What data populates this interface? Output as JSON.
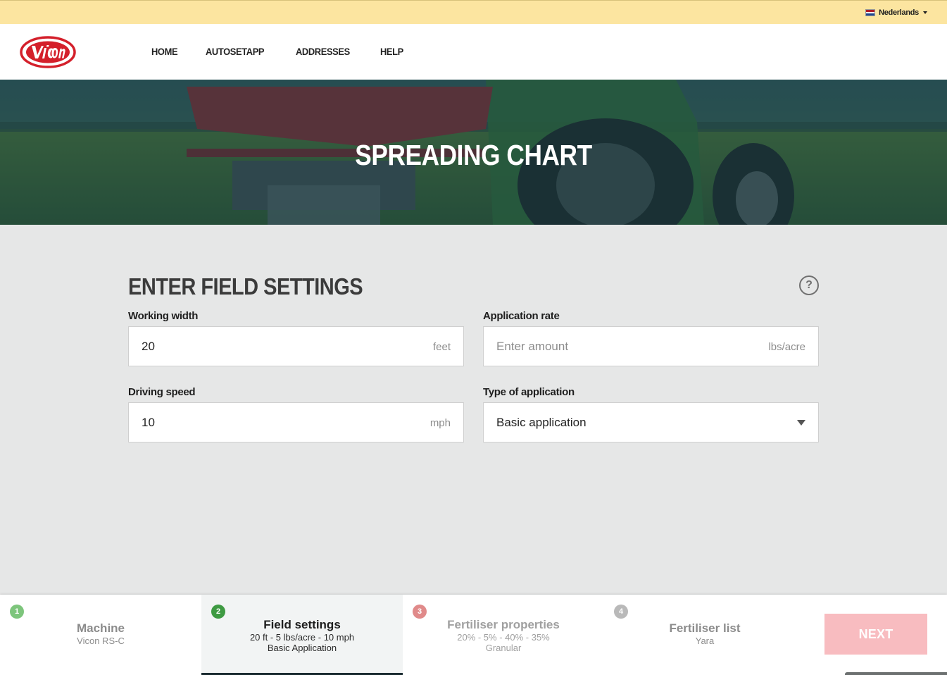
{
  "language": {
    "label": "Nederlands"
  },
  "nav": {
    "items": [
      "HOME",
      "AUTOSETAPP",
      "ADDRESSES",
      "HELP"
    ]
  },
  "hero": {
    "title": "SPREADING CHART"
  },
  "form": {
    "title": "ENTER FIELD SETTINGS",
    "help_symbol": "?",
    "working_width": {
      "label": "Working width",
      "value": "20",
      "placeholder": "",
      "unit": "feet"
    },
    "application_rate": {
      "label": "Application rate",
      "value": "",
      "placeholder": "Enter amount",
      "unit": "lbs/acre"
    },
    "driving_speed": {
      "label": "Driving speed",
      "value": "10",
      "placeholder": "",
      "unit": "mph"
    },
    "application_type": {
      "label": "Type of application",
      "selected": "Basic application"
    }
  },
  "steps": [
    {
      "number": "1",
      "title": "Machine",
      "lines": [
        "Vicon RS-C"
      ],
      "status": "done",
      "color": "#7dc57c"
    },
    {
      "number": "2",
      "title": "Field settings",
      "lines": [
        "20 ft - 5 lbs/acre - 10 mph",
        "Basic Application"
      ],
      "status": "active",
      "color": "#3e9a42"
    },
    {
      "number": "3",
      "title": "Fertiliser properties",
      "lines": [
        "20% - 5% - 40% - 35%",
        "Granular"
      ],
      "status": "error",
      "color": "#e08a8a"
    },
    {
      "number": "4",
      "title": "Fertiliser list",
      "lines": [
        "Yara"
      ],
      "status": "pending",
      "color": "#b9b9b9"
    }
  ],
  "next_button": {
    "label": "NEXT",
    "enabled": false,
    "color": "#f8bcc0"
  },
  "colors": {
    "topbar": "#fce5a0",
    "brand_red": "#d4202b",
    "background": "#e6e7e7"
  }
}
